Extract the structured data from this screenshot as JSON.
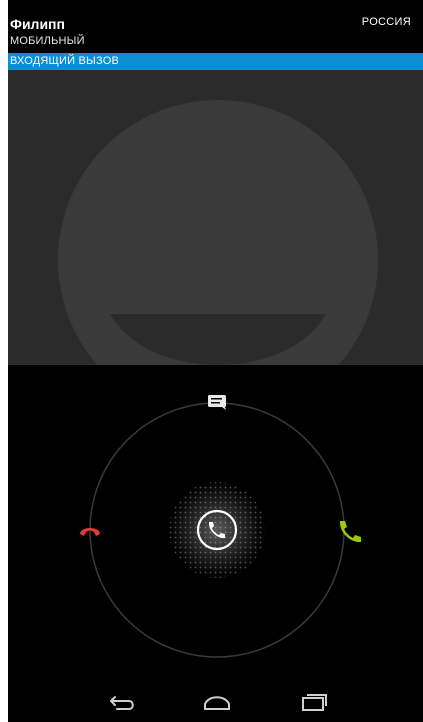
{
  "caller": {
    "name": "Филипп",
    "phone_type": "МОБИЛЬНЫЙ",
    "region": "РОССИЯ"
  },
  "call_status": "ВХОДЯЩИЙ ВЫЗОВ",
  "icons": {
    "avatar": "default-contact-silhouette",
    "message": "message-icon",
    "decline": "decline-call-icon",
    "answer": "answer-call-icon",
    "center": "call-handle-icon",
    "nav_back": "back-icon",
    "nav_home": "home-icon",
    "nav_recents": "recent-apps-icon"
  },
  "colors": {
    "status_bar": "#0b8fd0",
    "decline": "#e53935",
    "answer": "#99cc00",
    "photo_bg": "#2b2b2b",
    "avatar": "#3a3a3a"
  }
}
